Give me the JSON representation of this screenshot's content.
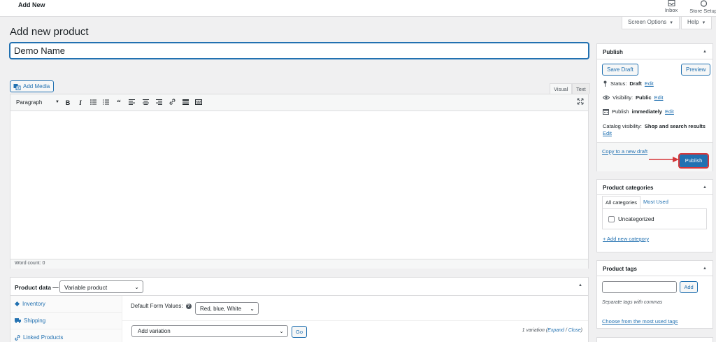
{
  "topbar": {
    "title": "Add New",
    "inbox_label": "Inbox",
    "store_setup_label": "Store Setup"
  },
  "screen_options": {
    "label": "Screen Options",
    "help_label": "Help"
  },
  "page": {
    "title": "Add new product",
    "product_name_value": "Demo Name"
  },
  "editor": {
    "add_media_label": "Add Media",
    "tab_visual": "Visual",
    "tab_text": "Text",
    "format_select_value": "Paragraph",
    "word_count": "Word count: 0"
  },
  "product_data": {
    "label": "Product data —",
    "type_value": "Variable product",
    "tabs": [
      {
        "label": "Inventory",
        "icon": "diamond-icon"
      },
      {
        "label": "Shipping",
        "icon": "truck-icon"
      },
      {
        "label": "Linked Products",
        "icon": "link-icon"
      }
    ],
    "default_form_values_label": "Default Form Values:",
    "default_form_values_value": "Red, blue, White",
    "add_variation_value": "Add variation",
    "go_label": "Go",
    "variation_count": "1 variation",
    "expand_label": "Expand",
    "close_label": "Close"
  },
  "publish_box": {
    "title": "Publish",
    "save_draft_label": "Save Draft",
    "preview_label": "Preview",
    "status_label": "Status:",
    "status_value": "Draft",
    "visibility_label": "Visibility:",
    "visibility_value": "Public",
    "publish_label": "Publish",
    "publish_value": "immediately",
    "catalog_label": "Catalog visibility:",
    "catalog_value": "Shop and search results",
    "edit_label": "Edit",
    "copy_label": "Copy to a new draft",
    "publish_button_label": "Publish"
  },
  "categories_box": {
    "title": "Product categories",
    "tab_all": "All categories",
    "tab_most_used": "Most Used",
    "items": [
      {
        "label": "Uncategorized",
        "checked": false
      }
    ],
    "add_new_label": "+ Add new category"
  },
  "tags_box": {
    "title": "Product tags",
    "add_label": "Add",
    "hint": "Separate tags with commas",
    "choose_label": "Choose from the most used tags"
  },
  "colors": {
    "accent": "#2271b1",
    "highlight": "#d63638"
  }
}
